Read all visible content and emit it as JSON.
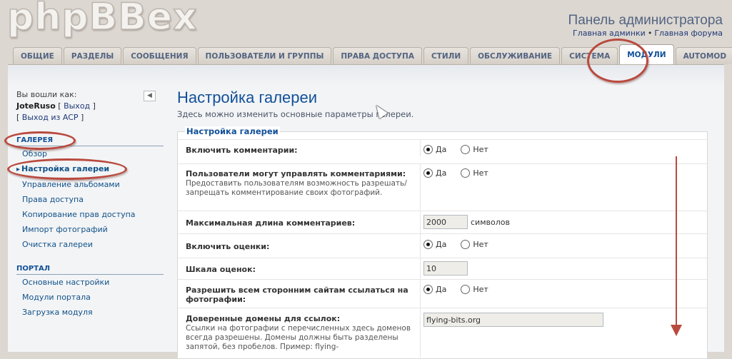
{
  "header": {
    "logo_text": "phpBBex",
    "title": "Панель администратора",
    "links": [
      "Главная админки",
      "Главная форума"
    ],
    "separator": "•"
  },
  "tabs": [
    {
      "label": "Общие",
      "active": false
    },
    {
      "label": "Разделы",
      "active": false
    },
    {
      "label": "Сообщения",
      "active": false
    },
    {
      "label": "Пользователи и группы",
      "active": false
    },
    {
      "label": "Права доступа",
      "active": false
    },
    {
      "label": "Стили",
      "active": false
    },
    {
      "label": "Обслуживание",
      "active": false
    },
    {
      "label": "Система",
      "active": false
    },
    {
      "label": "Модули",
      "active": true
    },
    {
      "label": "Automod",
      "active": false
    }
  ],
  "sidebar": {
    "logged_in_as": "Вы вошли как:",
    "username": "JoteRuso",
    "logout_link": "Выход",
    "exit_acp_link": "Выход из ACP",
    "collapse_icon": "triangle-left",
    "sections": [
      {
        "heading": "Галерея",
        "items": [
          {
            "label": "Обзор",
            "active": false
          },
          {
            "label": "Настройка галереи",
            "active": true
          },
          {
            "label": "Управление альбомами",
            "active": false
          },
          {
            "label": "Права доступа",
            "active": false
          },
          {
            "label": "Копирование прав доступа",
            "active": false
          },
          {
            "label": "Импорт фотографий",
            "active": false
          },
          {
            "label": "Очистка галереи",
            "active": false
          }
        ]
      },
      {
        "heading": "Портал",
        "items": [
          {
            "label": "Основные настройки",
            "active": false
          },
          {
            "label": "Модули портала",
            "active": false
          },
          {
            "label": "Загрузка модуля",
            "active": false
          }
        ]
      }
    ]
  },
  "main": {
    "title": "Настройка галереи",
    "description": "Здесь можно изменить основные параметры галереи.",
    "fieldset_legend": "Настройка галереи",
    "yes_label": "Да",
    "no_label": "Нет",
    "settings": [
      {
        "label": "Включить комментарии:",
        "type": "radio",
        "value": "yes"
      },
      {
        "label": "Пользователи могут управлять комментариями:",
        "explain": "Предоставить пользователям возможность разрешать/запрещать комментирование своих фотографий.",
        "type": "radio",
        "value": "yes"
      },
      {
        "label": "Максимальная длина комментариев:",
        "type": "text",
        "value": "2000",
        "unit": "символов"
      },
      {
        "label": "Включить оценки:",
        "type": "radio",
        "value": "yes"
      },
      {
        "label": "Шкала оценок:",
        "type": "text",
        "value": "10"
      },
      {
        "label": "Разрешить всем сторонним сайтам ссылаться на фотографии:",
        "type": "radio",
        "value": "yes"
      },
      {
        "label": "Доверенные домены для ссылок:",
        "explain": "Ссылки на фотографии с перечисленных здесь доменов всегда разрешены. Домены должны быть разделены запятой, без пробелов. Пример: flying-",
        "type": "text",
        "value": "flying-bits.org"
      }
    ]
  },
  "colors": {
    "accent": "#115098",
    "annotation": "#b94a3e",
    "background": "#dcd7d1"
  }
}
